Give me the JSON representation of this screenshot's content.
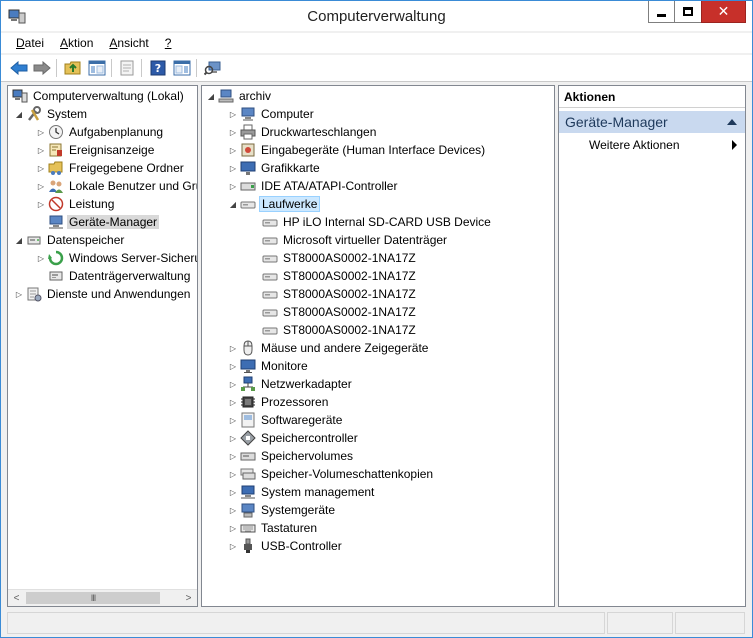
{
  "window": {
    "title": "Computerverwaltung"
  },
  "menu": [
    {
      "label": "Datei",
      "mnemonic": "D",
      "rest": "atei"
    },
    {
      "label": "Aktion",
      "mnemonic": "A",
      "rest": "ktion"
    },
    {
      "label": "Ansicht",
      "mnemonic": "A",
      "rest": "nsicht"
    },
    {
      "label": "?",
      "mnemonic": "?",
      "rest": ""
    }
  ],
  "left_tree": {
    "root": "Computerverwaltung (Lokal)",
    "system": "System",
    "aufgabenplanung": "Aufgabenplanung",
    "ereignisanzeige": "Ereignisanzeige",
    "freigegebene_ordner": "Freigegebene Ordner",
    "lokale_benutzer": "Lokale Benutzer und Gru",
    "leistung": "Leistung",
    "geraete_manager": "Geräte-Manager",
    "datenspeicher": "Datenspeicher",
    "windows_server_sicherung": "Windows Server-Sicheru",
    "datentraegerverwaltung": "Datenträgerverwaltung",
    "dienste": "Dienste und Anwendungen"
  },
  "device_tree": {
    "root": "archiv",
    "categories_before": [
      "Computer",
      "Druckwarteschlangen",
      "Eingabegeräte (Human Interface Devices)",
      "Grafikkarte",
      "IDE ATA/ATAPI-Controller"
    ],
    "expanded": "Laufwerke",
    "drives": [
      "HP iLO Internal SD-CARD USB Device",
      "Microsoft virtueller Datenträger",
      "ST8000AS0002-1NA17Z",
      "ST8000AS0002-1NA17Z",
      "ST8000AS0002-1NA17Z",
      "ST8000AS0002-1NA17Z",
      "ST8000AS0002-1NA17Z"
    ],
    "categories_after": [
      "Mäuse und andere Zeigegeräte",
      "Monitore",
      "Netzwerkadapter",
      "Prozessoren",
      "Softwaregeräte",
      "Speichercontroller",
      "Speichervolumes",
      "Speicher-Volumeschattenkopien",
      "System management",
      "Systemgeräte",
      "Tastaturen",
      "USB-Controller"
    ]
  },
  "actions": {
    "header": "Aktionen",
    "section": "Geräte-Manager",
    "item": "Weitere Aktionen"
  },
  "scrollbar": {
    "thumb_glyph": "III"
  },
  "colors": {
    "selection": "#cce8ff",
    "action_section": "#c9d9ef",
    "close": "#c7302a"
  }
}
